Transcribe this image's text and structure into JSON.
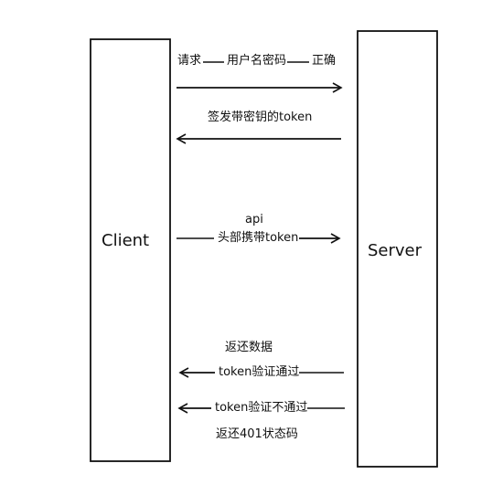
{
  "diagram": {
    "client_label": "Client",
    "server_label": "Server",
    "messages": {
      "request_left": "请求",
      "request_mid": "用户名密码",
      "request_right": "正确",
      "token_issued": "签发带密钥的token",
      "api_call": "api",
      "api_header": "头部携带token",
      "return_data": "返还数据",
      "token_valid": "token验证通过",
      "token_invalid": "token验证不通过",
      "return_401": "返还401状态码"
    }
  }
}
